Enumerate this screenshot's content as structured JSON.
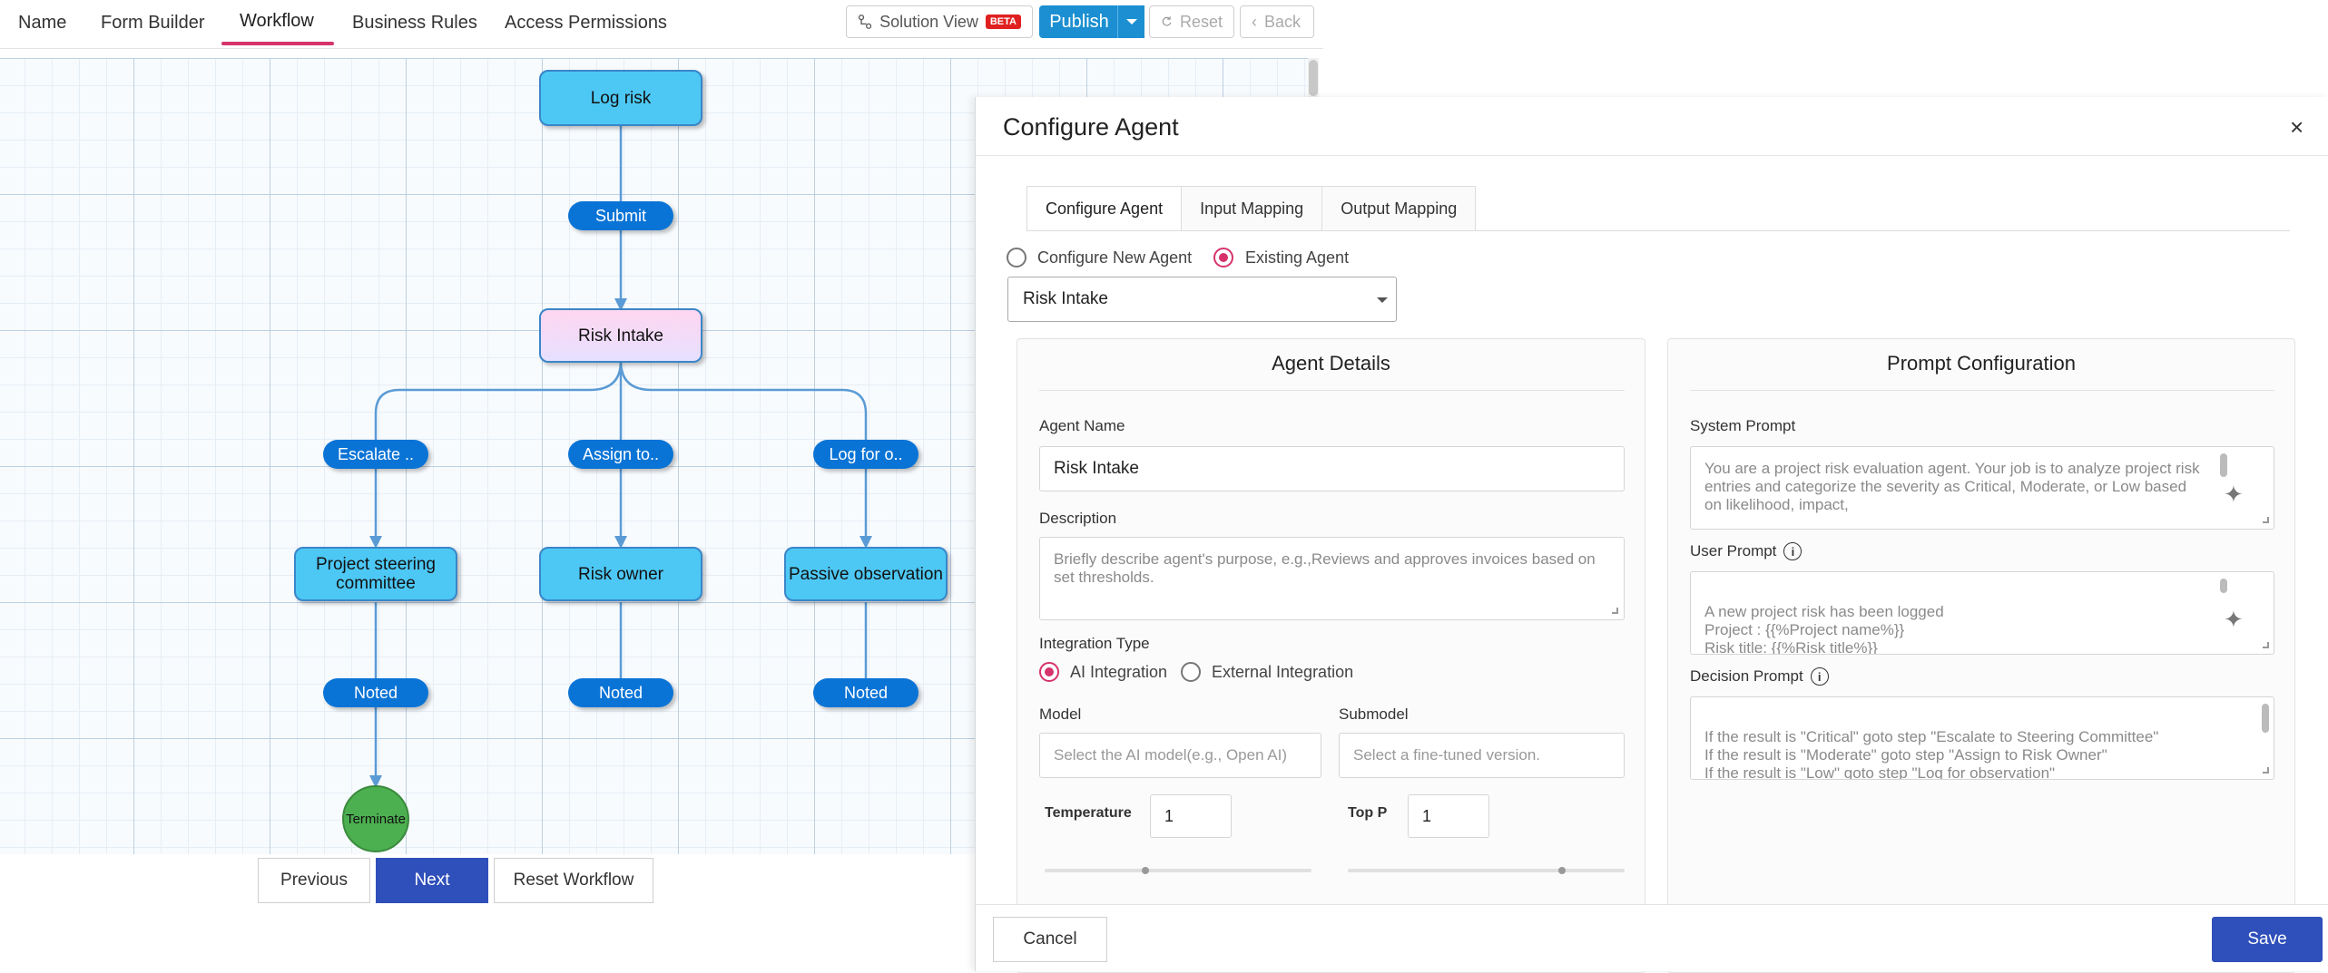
{
  "nav": {
    "tabs": [
      "Name",
      "Form Builder",
      "Workflow",
      "Business Rules",
      "Access Permissions"
    ],
    "solution_view": "Solution View",
    "beta": "BETA",
    "publish": "Publish",
    "reset": "Reset",
    "back": "Back"
  },
  "workflow": {
    "nodes": {
      "log_risk": "Log risk",
      "risk_intake": "Risk Intake",
      "steering": "Project steering committee",
      "risk_owner": "Risk owner",
      "passive": "Passive observation",
      "terminate": "Terminate"
    },
    "actions": {
      "submit": "Submit",
      "escalate": "Escalate ..",
      "assign": "Assign to..",
      "log_for": "Log for o..",
      "noted": "Noted"
    },
    "buttons": {
      "previous": "Previous",
      "next": "Next",
      "reset_workflow": "Reset Workflow"
    }
  },
  "panel": {
    "title": "Configure Agent",
    "close": "×",
    "tabs": [
      "Configure Agent",
      "Input Mapping",
      "Output Mapping"
    ],
    "agent_mode": {
      "new": "Configure New Agent",
      "existing": "Existing Agent",
      "selected": "existing"
    },
    "agent_select": "Risk Intake",
    "details": {
      "title": "Agent Details",
      "name_label": "Agent Name",
      "name_value": "Risk Intake",
      "description_label": "Description",
      "description_placeholder": "Briefly describe agent's purpose, e.g.,Reviews and approves invoices based on set thresholds.",
      "integration_label": "Integration Type",
      "integration_ai": "AI Integration",
      "integration_external": "External Integration",
      "model_label": "Model",
      "model_placeholder": "Select the AI model(e.g., Open AI)",
      "submodel_label": "Submodel",
      "submodel_placeholder": "Select a fine-tuned version.",
      "temperature_label": "Temperature",
      "temperature_value": "1",
      "top_p_label": "Top P",
      "top_p_value": "1"
    },
    "prompt": {
      "title": "Prompt Configuration",
      "system_label": "System Prompt",
      "system_text": "You are a project risk evaluation agent. Your job is to analyze project risk entries and categorize the severity as Critical, Moderate, or Low based on likelihood, impact,",
      "user_label": "User Prompt",
      "user_text": "A new project risk has been logged\nProject : {{%Project name%}}\nRisk title: {{%Risk title%}}",
      "decision_label": "Decision Prompt",
      "decision_text": "If the result is \"Critical\" goto step \"Escalate to Steering Committee\"\nIf the result is \"Moderate\" goto step \"Assign to Risk Owner\"\nIf the result is \"Low\" goto step \"Log for observation\""
    },
    "footer": {
      "cancel": "Cancel",
      "save": "Save"
    }
  }
}
